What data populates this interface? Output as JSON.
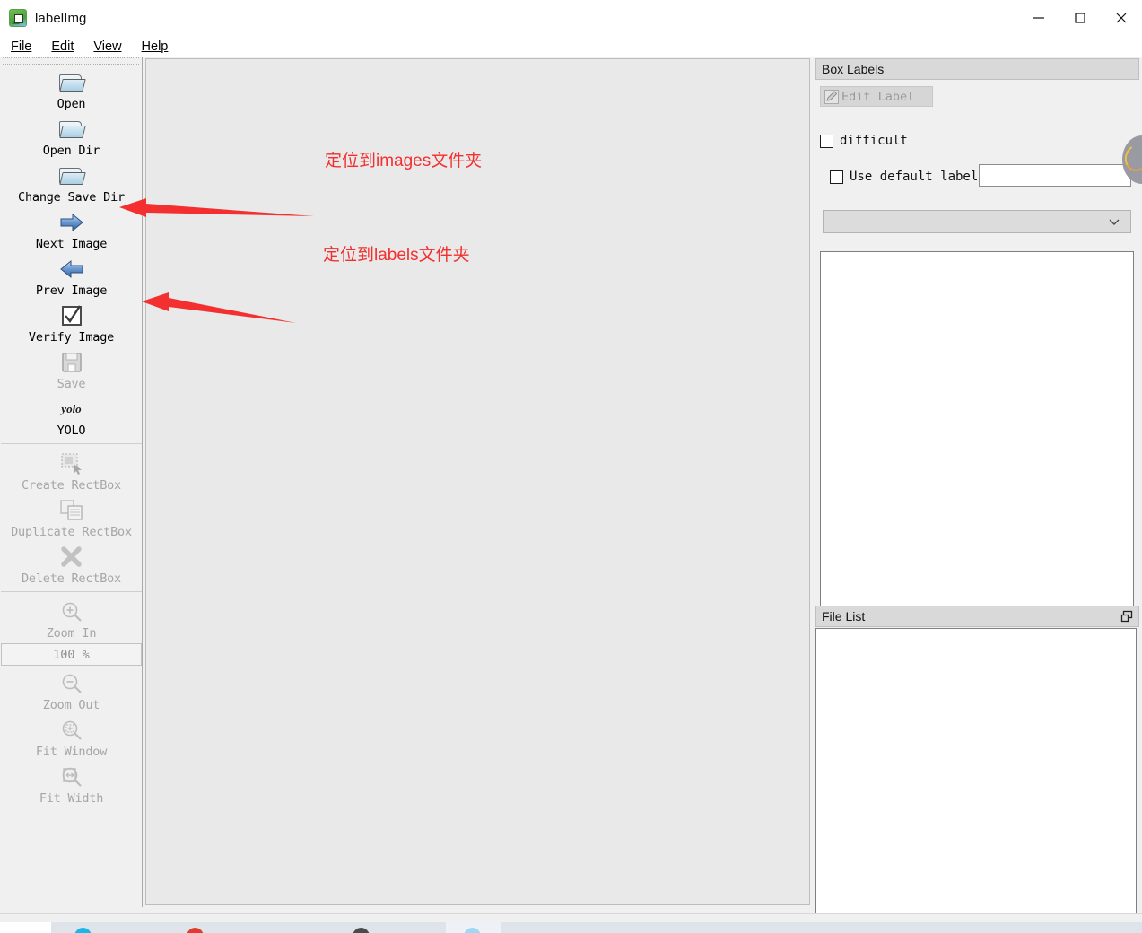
{
  "window": {
    "title": "labelImg",
    "icon": "labelimg-app-icon",
    "minimize": "−",
    "maximize": "□",
    "close": "✕"
  },
  "menubar": {
    "items": [
      {
        "label": "File",
        "mnemonic": "F"
      },
      {
        "label": "Edit",
        "mnemonic": "E"
      },
      {
        "label": "View",
        "mnemonic": "V"
      },
      {
        "label": "Help",
        "mnemonic": "H"
      }
    ]
  },
  "toolbar": {
    "items": [
      {
        "label": "Open",
        "icon": "open-folder-icon",
        "enabled": true
      },
      {
        "label": "Open Dir",
        "icon": "open-folder-icon",
        "enabled": true
      },
      {
        "label": "Change Save Dir",
        "icon": "open-folder-icon",
        "enabled": true
      },
      {
        "label": "Next Image",
        "icon": "arrow-right-icon",
        "enabled": true
      },
      {
        "label": "Prev Image",
        "icon": "arrow-left-icon",
        "enabled": true
      },
      {
        "label": "Verify Image",
        "icon": "checkbox-check-icon",
        "enabled": true
      },
      {
        "label": "Save",
        "icon": "floppy-disk-icon",
        "enabled": false
      },
      {
        "label": "YOLO",
        "icon": "yolo-format-icon",
        "enabled": true
      },
      {
        "label": "Create RectBox",
        "icon": "create-rect-icon",
        "enabled": false
      },
      {
        "label": "Duplicate RectBox",
        "icon": "duplicate-rect-icon",
        "enabled": false
      },
      {
        "label": "Delete RectBox",
        "icon": "delete-rect-x-icon",
        "enabled": false
      },
      {
        "label": "Zoom In",
        "icon": "magnifier-plus-icon",
        "enabled": false
      },
      {
        "label": "Zoom Out",
        "icon": "magnifier-minus-icon",
        "enabled": false
      },
      {
        "label": "Fit Window",
        "icon": "magnifier-fit-window-icon",
        "enabled": false
      },
      {
        "label": "Fit Width",
        "icon": "magnifier-fit-width-icon",
        "enabled": false
      }
    ],
    "yolo_icon_text": "yolo",
    "zoom_value": "100 %"
  },
  "box_labels": {
    "title": "Box Labels",
    "edit_label_button": "Edit Label",
    "difficult_label": "difficult",
    "difficult_checked": false,
    "use_default_label": "Use default label",
    "use_default_checked": false,
    "default_label_value": "",
    "default_label_placeholder": "",
    "combo_selected": "",
    "label_list_items": []
  },
  "file_list": {
    "title": "File List",
    "items": [],
    "float_icon": "undock-icon"
  },
  "annotations": [
    {
      "text": "定位到images文件夹",
      "color": "#f3302f"
    },
    {
      "text": "定位到labels文件夹",
      "color": "#f3302f"
    }
  ],
  "colors": {
    "annotation_red": "#f3302f",
    "canvas_bg": "#e9e9e9",
    "panel_bg": "#f0f0f0",
    "dock_title_bg": "#d9d9d9",
    "disabled_text": "#a6a6a6"
  }
}
